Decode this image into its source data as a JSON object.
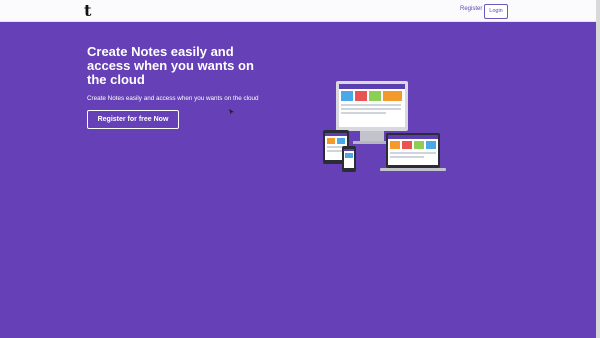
{
  "navbar": {
    "logo_text": "t",
    "register_label": "Register",
    "login_label": "Login"
  },
  "hero": {
    "title": "Create Notes easily and access when you wants on the cloud",
    "subtitle": "Create Notes easily and access when you wants on the cloud",
    "cta_label": "Register for free Now"
  },
  "colors": {
    "hero_bg": "#6540b6",
    "nav_bg": "#fbfbfe",
    "accent": "#5b4bb0"
  },
  "icons": {
    "logo": "logo-icon",
    "illustration": "devices-illustration",
    "cursor": "cursor-icon"
  }
}
